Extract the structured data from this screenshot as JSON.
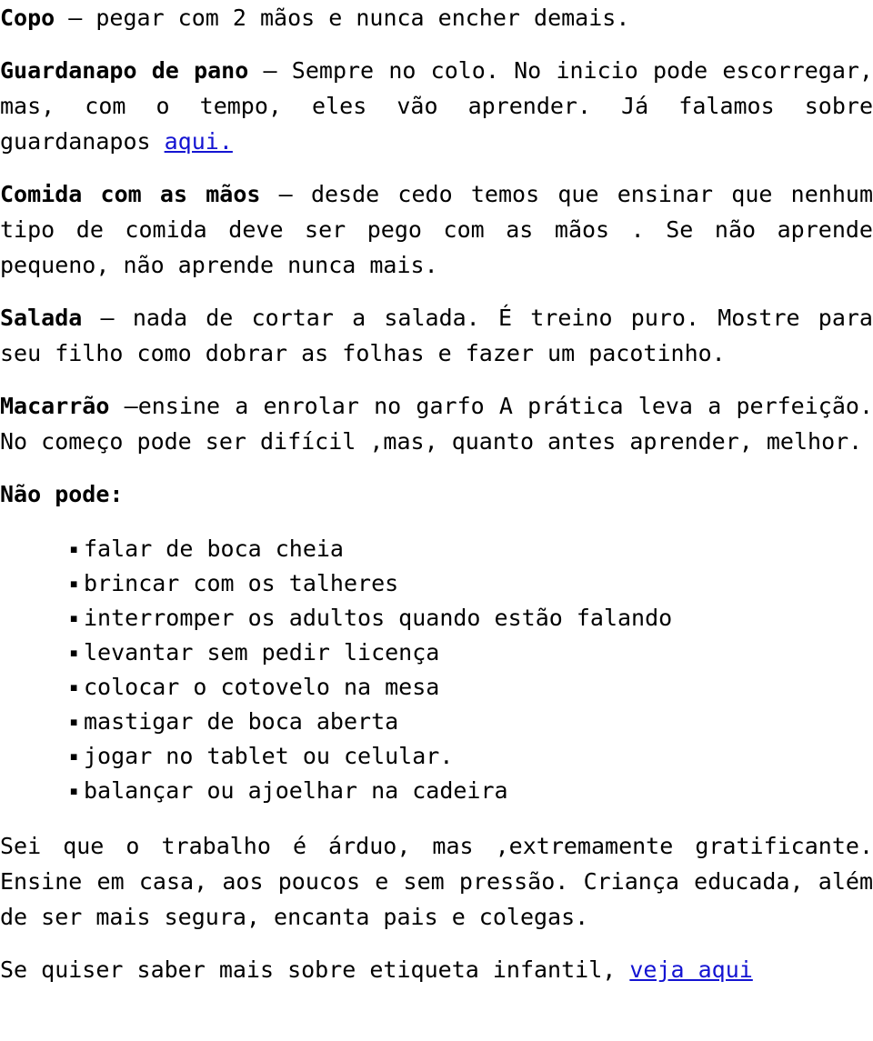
{
  "document": {
    "language": "pt-BR",
    "background_color": "#ffffff",
    "text_color": "#000000",
    "link_color": "#1414d2",
    "paragraphs": [
      {
        "id": "copo",
        "lead": "Copo",
        "body": " – pegar com 2 mãos e nunca encher demais."
      },
      {
        "id": "guardanapo",
        "lead": "Guardanapo de pano",
        "body_before_link": " – Sempre no colo. No inicio pode escorregar, mas, com o tempo, eles vão aprender. Já falamos sobre guardanapos ",
        "link_text": "aqui.",
        "body_after_link": ""
      },
      {
        "id": "comida-com-as-maos",
        "lead": "Comida com as mãos",
        "body": " – desde cedo temos que ensinar que nenhum tipo de comida deve ser pego com as mãos . Se não aprende pequeno, não aprende nunca mais."
      },
      {
        "id": "salada",
        "lead": "Salada",
        "body": " – nada de cortar a salada. É treino puro. Mostre para seu filho como dobrar as folhas e fazer um pacotinho."
      },
      {
        "id": "macarrao",
        "lead": "Macarrão",
        "body": " –ensine a enrolar no garfo A prática leva a perfeição. No começo pode ser difícil ,mas, quanto antes aprender, melhor."
      }
    ],
    "donts_heading": "Não pode:",
    "donts_bullet_glyph": "▪",
    "donts": [
      "falar de boca cheia",
      "brincar com os talheres",
      "interromper os adultos quando estão falando",
      "levantar sem pedir licença",
      "colocar o cotovelo na mesa",
      "mastigar de boca aberta",
      "jogar no tablet ou celular.",
      "balançar ou ajoelhar na cadeira"
    ],
    "closing_paragraph": "Sei que o trabalho é árduo, mas ,extremamente gratificante. Ensine em casa, aos poucos e sem pressão. Criança educada, além de ser mais segura, encanta pais e colegas.",
    "final_paragraph": {
      "text_before_link": "Se quiser saber mais sobre etiqueta infantil, ",
      "link_text": "veja aqui"
    }
  }
}
